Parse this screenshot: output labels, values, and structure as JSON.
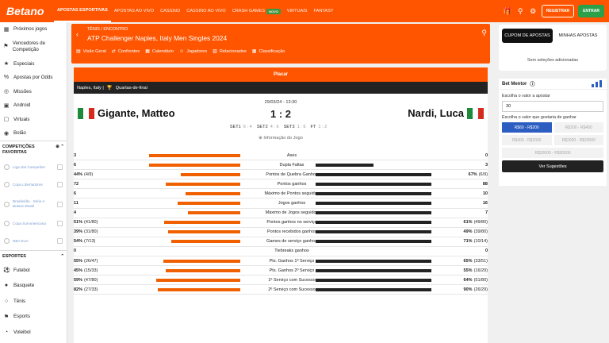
{
  "header": {
    "logo": "Betano",
    "nav": [
      {
        "label": "APOSTAS ESPORTIVAS",
        "active": true
      },
      {
        "label": "APOSTAS AO VIVO"
      },
      {
        "label": "CASSINO"
      },
      {
        "label": "CASSINO AO VIVO"
      },
      {
        "label": "CRASH GAMES",
        "badge": "NOVO"
      },
      {
        "label": "VIRTUAIS"
      },
      {
        "label": "FANTASY"
      }
    ],
    "register_label": "REGISTRAR",
    "login_label": "ENTRAR",
    "icons": [
      "gift-icon",
      "search-icon",
      "settings-icon"
    ]
  },
  "sidebar": {
    "items": [
      {
        "icon": "calendar-icon",
        "label": "Próximos jogos"
      },
      {
        "icon": "trophy-icon",
        "label": "Vencedores de Competição"
      },
      {
        "icon": "star-icon",
        "label": "Especiais"
      },
      {
        "icon": "percent-icon",
        "label": "Apostas por Odds"
      },
      {
        "icon": "target-icon",
        "label": "Missões"
      },
      {
        "icon": "android-icon",
        "label": "Android"
      },
      {
        "icon": "virtual-icon",
        "label": "Virtuais"
      },
      {
        "icon": "pot-icon",
        "label": "Bolão"
      }
    ],
    "favorites_heading": "COMPETIÇÕES FAVORITAS",
    "favorites": [
      {
        "label": "Liga dos Campeões"
      },
      {
        "label": "Copa Libertadores"
      },
      {
        "label": "Brasileirão - Série A Betano Brasil"
      },
      {
        "label": "Copa Sul-americana"
      },
      {
        "label": "NBA EUA"
      }
    ],
    "sports_heading": "ESPORTES",
    "sports": [
      {
        "icon": "soccer-icon",
        "label": "Futebol"
      },
      {
        "icon": "basketball-icon",
        "label": "Basquete"
      },
      {
        "icon": "tennis-icon",
        "label": "Tênis"
      },
      {
        "icon": "trophy-icon",
        "label": "Esports"
      },
      {
        "icon": "volleyball-icon",
        "label": "Voleibol"
      }
    ]
  },
  "event": {
    "breadcrumb": "TÊNIS / ENCONTRO",
    "title": "ATP Challenger Naples, Italy Men Singles 2024",
    "tabs": [
      {
        "icon": "overview-icon",
        "label": "Visão Geral"
      },
      {
        "icon": "h2h-icon",
        "label": "Confrontos"
      },
      {
        "icon": "calendar-icon",
        "label": "Calendário"
      },
      {
        "icon": "players-icon",
        "label": "Jogadores"
      },
      {
        "icon": "results-icon",
        "label": "Relacionados"
      },
      {
        "icon": "table-icon",
        "label": "Classificação"
      }
    ],
    "placar_label": "Placar",
    "league": "Naples, Italy |",
    "round": "Quartas-de-final",
    "datetime": "29/03/24 - 13:30",
    "player_left": "Gigante, Matteo",
    "player_right": "Nardi, Luca",
    "score": "1 : 2",
    "sets": [
      {
        "label": "SET1",
        "score": "6 : 4"
      },
      {
        "label": "SET2",
        "score": "4 : 6"
      },
      {
        "label": "SET3",
        "score": "1 : 6"
      },
      {
        "label": "FT",
        "score": "1 : 2"
      }
    ],
    "info_label": "Informação do Jogo"
  },
  "stats": [
    {
      "label": "Ases",
      "left": "3",
      "right": "0",
      "l": 3,
      "r": 0,
      "max": 3
    },
    {
      "label": "Dupla Faltas",
      "left": "6",
      "right": "3",
      "l": 6,
      "r": 3,
      "max": 6
    },
    {
      "label": "Pontos de Quebra Ganhos",
      "left": "44%",
      "left_p": "(4/9)",
      "right": "67%",
      "right_p": "(6/9)",
      "l": 44,
      "r": 67,
      "max": 67
    },
    {
      "label": "Pontos ganhos",
      "left": "72",
      "right": "88",
      "l": 72,
      "r": 88,
      "max": 88
    },
    {
      "label": "Máximo de Pontos seguidos",
      "left": "6",
      "right": "10",
      "l": 6,
      "r": 10,
      "max": 10
    },
    {
      "label": "Jogos ganhos",
      "left": "11",
      "right": "16",
      "l": 11,
      "r": 16,
      "max": 16
    },
    {
      "label": "Máximo de Jogos seguidos",
      "left": "4",
      "right": "7",
      "l": 4,
      "r": 7,
      "max": 7
    },
    {
      "label": "Pontos ganhos no serviço",
      "left": "51%",
      "left_p": "(41/80)",
      "right": "61%",
      "right_p": "(49/80)",
      "l": 51,
      "r": 61,
      "max": 61
    },
    {
      "label": "Pontos recebidos ganhos",
      "left": "39%",
      "left_p": "(31/80)",
      "right": "49%",
      "right_p": "(39/80)",
      "l": 39,
      "r": 49,
      "max": 49
    },
    {
      "label": "Games de serviço ganhos",
      "left": "54%",
      "left_p": "(7/13)",
      "right": "71%",
      "right_p": "(10/14)",
      "l": 54,
      "r": 71,
      "max": 71
    },
    {
      "label": "Tiebreaks ganhos",
      "left": "0",
      "right": "0",
      "l": 0,
      "r": 0,
      "max": 1
    },
    {
      "label": "Pts. Ganhos 1º Serviço",
      "left": "55%",
      "left_p": "(26/47)",
      "right": "65%",
      "right_p": "(33/51)",
      "l": 55,
      "r": 65,
      "max": 65
    },
    {
      "label": "Pts. Ganhos 2º Serviço",
      "left": "45%",
      "left_p": "(15/33)",
      "right": "55%",
      "right_p": "(16/29)",
      "l": 45,
      "r": 55,
      "max": 55
    },
    {
      "label": "1º Serviço com Sucesso",
      "left": "59%",
      "left_p": "(47/80)",
      "right": "64%",
      "right_p": "(51/80)",
      "l": 59,
      "r": 64,
      "max": 64
    },
    {
      "label": "2º Serviço com Sucesso",
      "left": "82%",
      "left_p": "(27/33)",
      "right": "90%",
      "right_p": "(26/29)",
      "l": 82,
      "r": 90,
      "max": 90
    }
  ],
  "betslip": {
    "tab_active": "CUPOM DE APOSTAS",
    "tab_other": "MINHAS APOSTAS",
    "empty_text": "Sem seleções adicionadas"
  },
  "bet_mentor": {
    "title": "Bet Mentor",
    "stake_label": "Escolha o valor a apostar",
    "stake_value": "30",
    "win_label": "Escolha o valor que gostaria de ganhar",
    "options": [
      "R$60 - R$200",
      "R$200 - R$400",
      "R$400 - R$2000",
      "R$2000 - R$20000",
      "R$20000 - R$30000"
    ],
    "selected_option": 0,
    "suggest_label": "Ver Sugestões"
  },
  "colors": {
    "brand": "#ff5500",
    "left_bar": "#f06000",
    "right_bar": "#222222",
    "accent_blue": "#2b5ec0",
    "green": "#2aa04a"
  }
}
